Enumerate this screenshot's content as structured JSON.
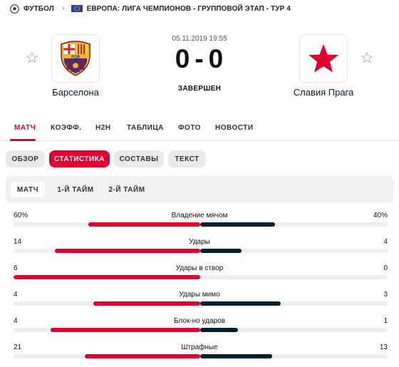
{
  "colors": {
    "accent": "#dd0030",
    "away_bar": "#00212c",
    "track": "#eceef0"
  },
  "breadcrumb": {
    "sport_icon": "football-icon",
    "sport": "ФУТБОЛ",
    "region_icon": "europe-flag-icon",
    "competition": "ЕВРОПА: ЛИГА ЧЕМПИОНОВ - ГРУППОВОЙ ЭТАП - ТУР 4"
  },
  "match": {
    "datetime": "05.11.2019 19:55",
    "home_score": "0",
    "separator": "-",
    "away_score": "0",
    "status": "ЗАВЕРШЕН",
    "home": {
      "name": "Барселона",
      "logo_text": "FCB"
    },
    "away": {
      "name": "Славия Прага"
    }
  },
  "main_tabs": [
    "МАТЧ",
    "КОЭФФ.",
    "H2H",
    "ТАБЛИЦА",
    "ФОТО",
    "НОВОСТИ"
  ],
  "sub_tabs": [
    "ОБЗОР",
    "СТАТИСТИКА",
    "СОСТАВЫ",
    "ТЕКСТ"
  ],
  "periods": [
    "МАТЧ",
    "1-Й ТАЙМ",
    "2-Й ТАЙМ"
  ],
  "stats": [
    {
      "name": "Владение мячом",
      "home": "60%",
      "away": "40%",
      "home_val": 60,
      "away_val": 40
    },
    {
      "name": "Удары",
      "home": "14",
      "away": "4",
      "home_val": 14,
      "away_val": 4
    },
    {
      "name": "Удары в створ",
      "home": "6",
      "away": "0",
      "home_val": 6,
      "away_val": 0
    },
    {
      "name": "Удары мимо",
      "home": "4",
      "away": "3",
      "home_val": 4,
      "away_val": 3
    },
    {
      "name": "Блок-но ударов",
      "home": "4",
      "away": "1",
      "home_val": 4,
      "away_val": 1
    },
    {
      "name": "Штрафные",
      "home": "21",
      "away": "13",
      "home_val": 21,
      "away_val": 13
    }
  ]
}
